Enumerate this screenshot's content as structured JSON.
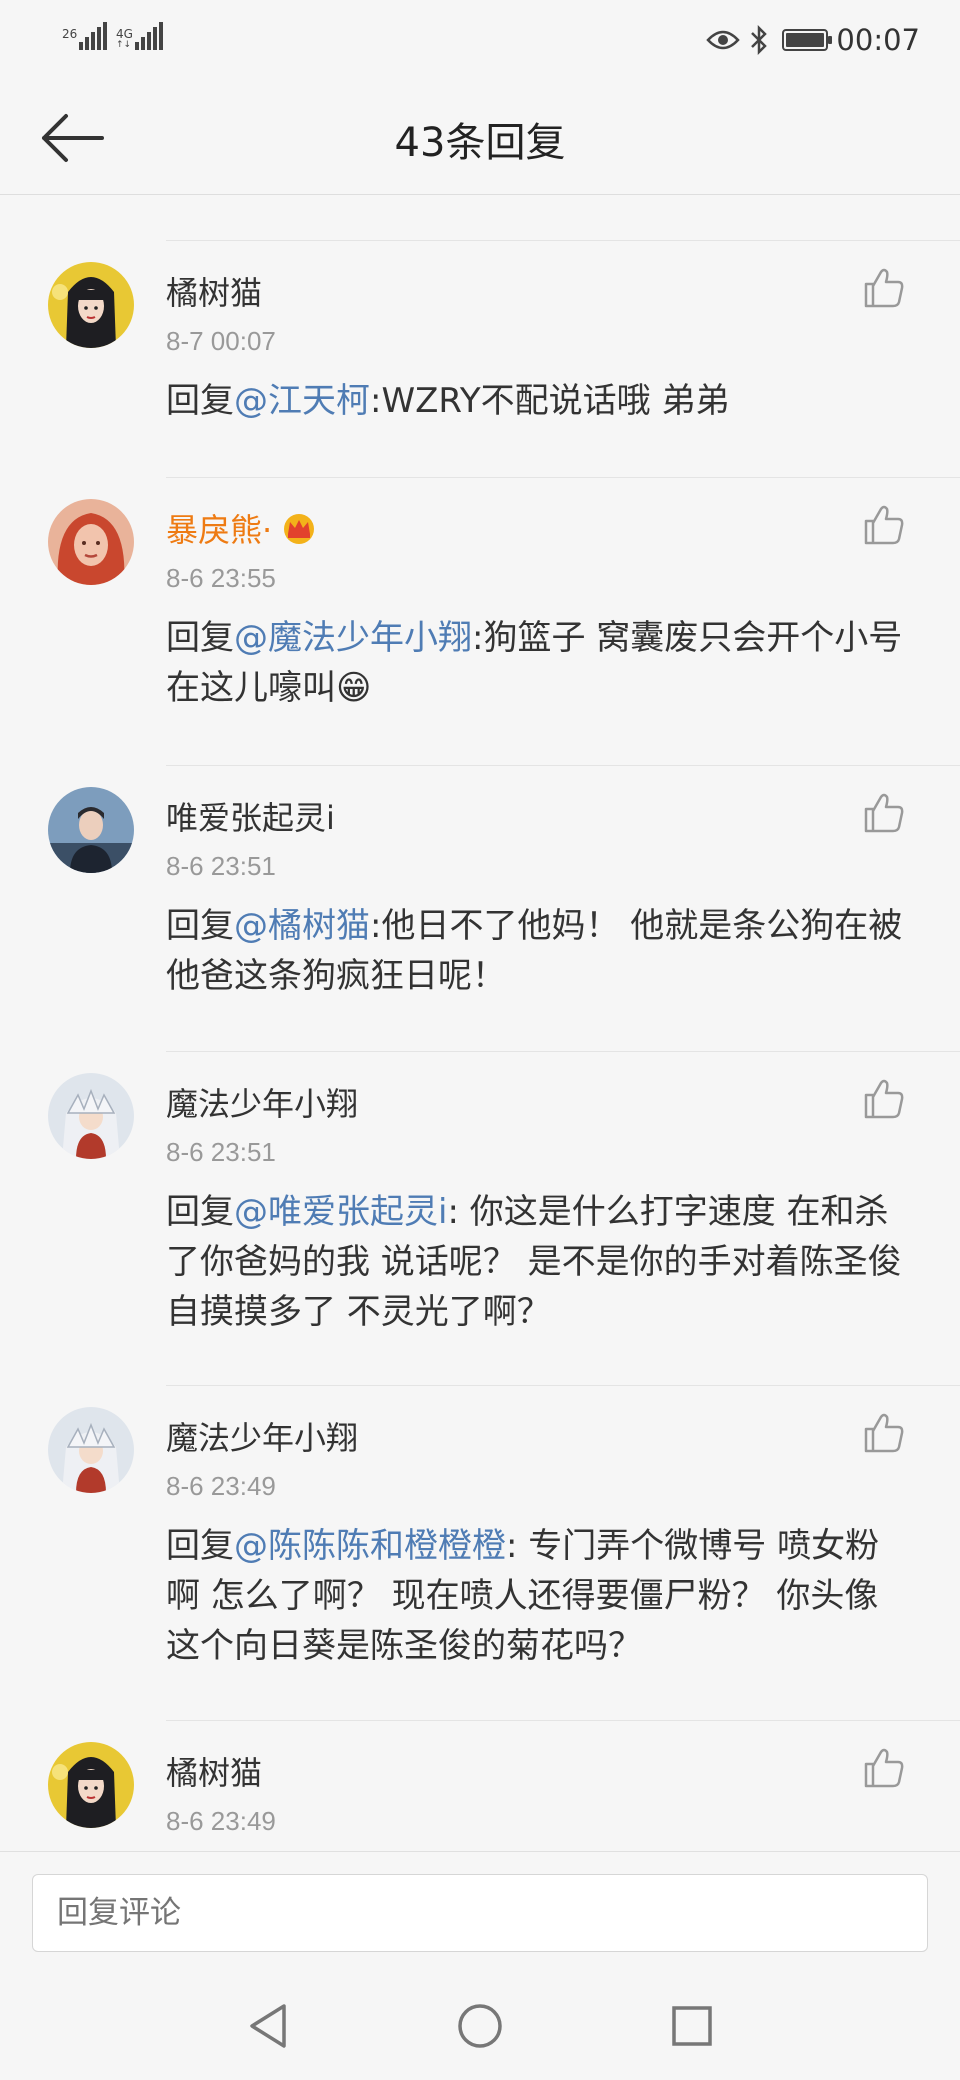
{
  "status_bar": {
    "sim1_label": "26",
    "sim2_label": "4G",
    "time": "00:07",
    "icons": [
      "eye-icon",
      "bluetooth-icon",
      "battery-icon"
    ]
  },
  "header": {
    "title": "43条回复",
    "back_icon": "arrow-left-icon"
  },
  "comments": [
    {
      "user": "橘树猫",
      "vip": false,
      "time": "8-7 00:07",
      "prefix": "回复",
      "mention": "@江天柯",
      "text": ":WZRY不配说话哦 弟弟"
    },
    {
      "user": "暴戾熊·",
      "vip": true,
      "badge_icon": "crown-icon",
      "time": "8-6 23:55",
      "prefix": "回复",
      "mention": "@魔法少年小翔",
      "text": ":狗篮子 窝囊废只会开个小号在这儿嚎叫😁"
    },
    {
      "user": "唯爱张起灵i",
      "vip": false,
      "time": "8-6 23:51",
      "prefix": "回复",
      "mention": "@橘树猫",
      "text": ":他日不了他妈！ 他就是条公狗在被他爸这条狗疯狂日呢！"
    },
    {
      "user": "魔法少年小翔",
      "vip": false,
      "time": "8-6 23:51",
      "prefix": "回复",
      "mention": "@唯爱张起灵i",
      "text": ": 你这是什么打字速度 在和杀了你爸妈的我 说话呢？ 是不是你的手对着陈圣俊自摸摸多了 不灵光了啊？"
    },
    {
      "user": "魔法少年小翔",
      "vip": false,
      "time": "8-6 23:49",
      "prefix": "回复",
      "mention": "@陈陈陈和橙橙橙",
      "text": ": 专门弄个微博号 喷女粉啊 怎么了啊？ 现在喷人还得要僵尸粉？ 你头像这个向日葵是陈圣俊的菊花吗？"
    },
    {
      "user": "橘树猫",
      "vip": false,
      "time": "8-6 23:49",
      "prefix": "",
      "mention": "",
      "text": ""
    }
  ],
  "reply_bar": {
    "placeholder": "回复评论"
  },
  "nav": {
    "icons": [
      "back-triangle-icon",
      "home-circle-icon",
      "recents-square-icon"
    ]
  }
}
